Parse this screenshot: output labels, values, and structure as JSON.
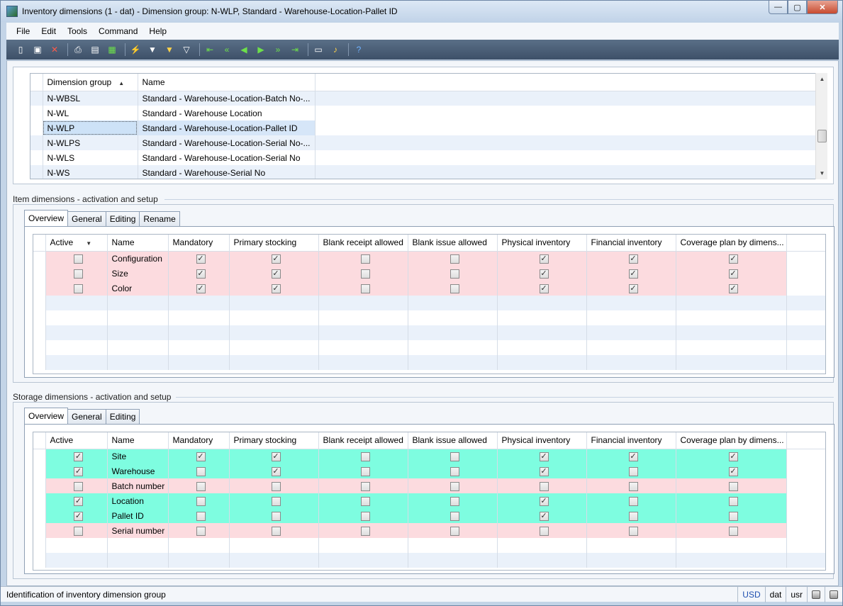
{
  "window": {
    "title": "Inventory dimensions (1 - dat) - Dimension group: N-WLP, Standard - Warehouse-Location-Pallet ID",
    "minimize": "—",
    "maximize": "▢",
    "close": "✕"
  },
  "menu": [
    "File",
    "Edit",
    "Tools",
    "Command",
    "Help"
  ],
  "toolbar_icons": [
    "new-icon",
    "save-icon",
    "delete-icon",
    "print-icon",
    "print-preview-icon",
    "excel-export-icon",
    "filter-by-selection-icon",
    "filter-by-grid-icon",
    "advanced-filter-icon",
    "remove-filter-icon",
    "first-record-icon",
    "previous-page-icon",
    "previous-record-icon",
    "next-record-icon",
    "next-page-icon",
    "last-record-icon",
    "document-handling-icon",
    "alert-icon",
    "help-icon"
  ],
  "dimension_groups": {
    "columns": [
      "Dimension group",
      "Name"
    ],
    "rows": [
      {
        "group": "N-WBSL",
        "name": "Standard - Warehouse-Location-Batch No-..."
      },
      {
        "group": "N-WL",
        "name": "Standard - Warehouse Location"
      },
      {
        "group": "N-WLP",
        "name": "Standard - Warehouse-Location-Pallet ID"
      },
      {
        "group": "N-WLPS",
        "name": "Standard - Warehouse-Location-Serial No-..."
      },
      {
        "group": "N-WLS",
        "name": "Standard - Warehouse-Location-Serial No"
      },
      {
        "group": "N-WS",
        "name": "Standard - Warehouse-Serial No"
      }
    ],
    "selected_index": 2
  },
  "item_dimensions": {
    "title": "Item dimensions - activation and setup",
    "tabs": [
      "Overview",
      "General",
      "Editing",
      "Rename"
    ],
    "columns": [
      "Active",
      "Name",
      "Mandatory",
      "Primary stocking",
      "Blank receipt allowed",
      "Blank issue allowed",
      "Physical inventory",
      "Financial inventory",
      "Coverage plan by dimens..."
    ],
    "rows": [
      {
        "name": "Configuration",
        "active": false,
        "mandatory": true,
        "primary": true,
        "blank_receipt": false,
        "blank_issue": false,
        "physical": true,
        "financial": true,
        "coverage": true
      },
      {
        "name": "Size",
        "active": false,
        "mandatory": true,
        "primary": true,
        "blank_receipt": false,
        "blank_issue": false,
        "physical": true,
        "financial": true,
        "coverage": true
      },
      {
        "name": "Color",
        "active": false,
        "mandatory": true,
        "primary": true,
        "blank_receipt": false,
        "blank_issue": false,
        "physical": true,
        "financial": true,
        "coverage": true
      }
    ]
  },
  "storage_dimensions": {
    "title": "Storage dimensions - activation and setup",
    "tabs": [
      "Overview",
      "General",
      "Editing"
    ],
    "columns": [
      "Active",
      "Name",
      "Mandatory",
      "Primary stocking",
      "Blank receipt allowed",
      "Blank issue allowed",
      "Physical inventory",
      "Financial inventory",
      "Coverage plan by dimens..."
    ],
    "rows": [
      {
        "name": "Site",
        "active": true,
        "mandatory": true,
        "primary": true,
        "blank_receipt": false,
        "blank_issue": false,
        "physical": true,
        "financial": true,
        "coverage": true
      },
      {
        "name": "Warehouse",
        "active": true,
        "mandatory": false,
        "primary": true,
        "blank_receipt": false,
        "blank_issue": false,
        "physical": true,
        "financial": false,
        "coverage": true
      },
      {
        "name": "Batch number",
        "active": false,
        "mandatory": false,
        "primary": false,
        "blank_receipt": false,
        "blank_issue": false,
        "physical": false,
        "financial": false,
        "coverage": false
      },
      {
        "name": "Location",
        "active": true,
        "mandatory": false,
        "primary": false,
        "blank_receipt": false,
        "blank_issue": false,
        "physical": true,
        "financial": false,
        "coverage": false
      },
      {
        "name": "Pallet ID",
        "active": true,
        "mandatory": false,
        "primary": false,
        "blank_receipt": false,
        "blank_issue": false,
        "physical": true,
        "financial": false,
        "coverage": false
      },
      {
        "name": "Serial number",
        "active": false,
        "mandatory": false,
        "primary": false,
        "blank_receipt": false,
        "blank_issue": false,
        "physical": false,
        "financial": false,
        "coverage": false
      }
    ]
  },
  "status": {
    "text": "Identification of inventory dimension group",
    "currency": "USD",
    "company": "dat",
    "user": "usr"
  },
  "colors": {
    "active_row": "#7efde0",
    "inactive_row": "#fcdbdf",
    "toolbar": "#4a5d75"
  }
}
